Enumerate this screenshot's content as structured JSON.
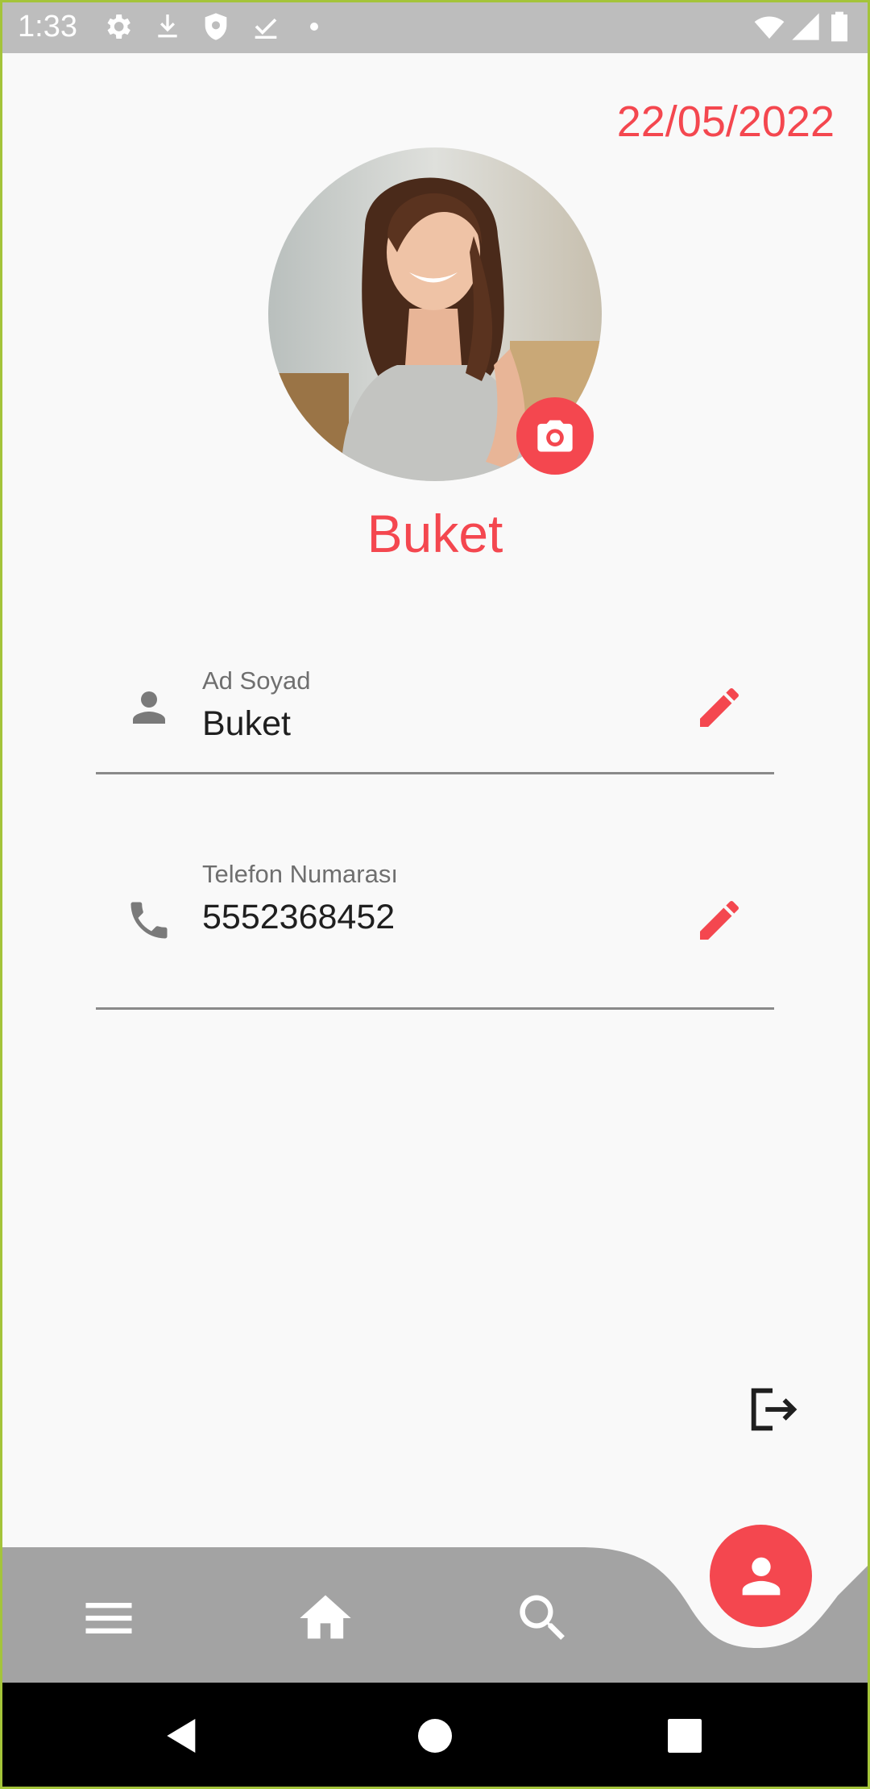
{
  "status_bar": {
    "time": "1:33",
    "icons": [
      "settings-icon",
      "download-icon",
      "shield-icon",
      "check-download-icon",
      "dot-icon",
      "wifi-icon",
      "signal-icon",
      "battery-icon"
    ]
  },
  "date": "22/05/2022",
  "profile": {
    "name": "Buket",
    "photo": "profile-photo-woman",
    "camera_icon": "camera-icon"
  },
  "fields": [
    {
      "label": "Ad Soyad",
      "value": "Buket",
      "icon": "person-icon",
      "edit_icon": "pencil-icon"
    },
    {
      "label": "Telefon Numarası",
      "value": "5552368452",
      "icon": "phone-icon",
      "edit_icon": "pencil-icon"
    }
  ],
  "logout_icon": "logout-icon",
  "bottom_nav": {
    "items": [
      "menu-icon",
      "home-icon",
      "search-icon"
    ],
    "active": "profile-icon"
  },
  "system_nav": [
    "back-icon",
    "home-circle-icon",
    "recents-icon"
  ],
  "colors": {
    "accent": "#f4474f",
    "nav_bar": "#a3a3a3",
    "status_bar": "#bdbdbd",
    "background": "#f9f9f9"
  }
}
